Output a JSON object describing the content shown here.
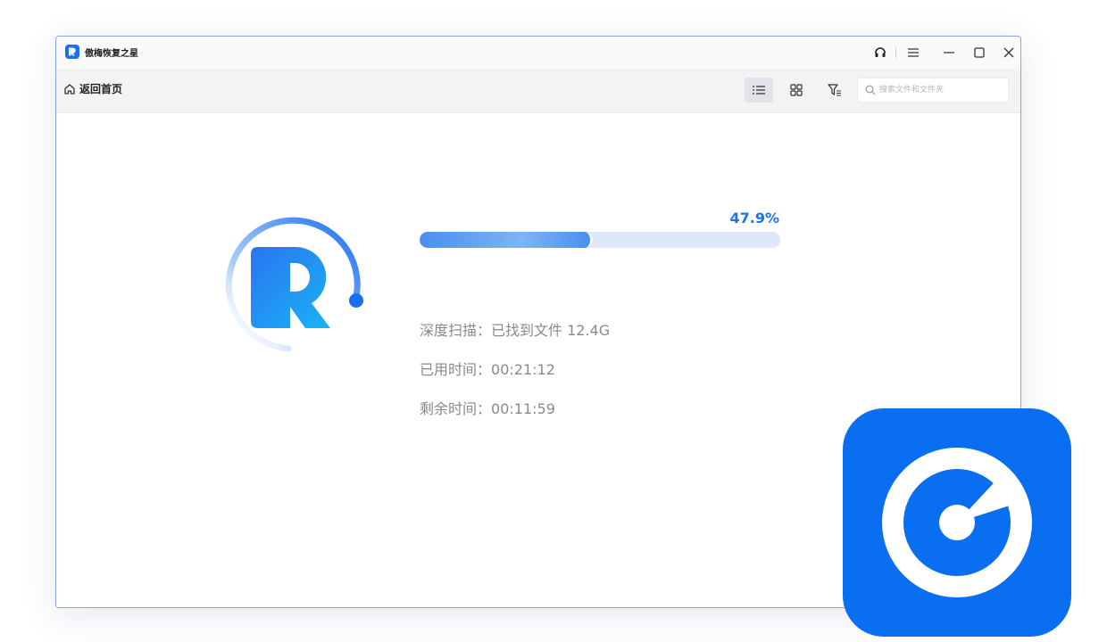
{
  "app": {
    "title": "傲梅恢复之星"
  },
  "toolbar": {
    "home_label": "返回首页",
    "search_placeholder": "搜索文件和文件夹"
  },
  "scan": {
    "progress_percent_label": "47.9%",
    "progress_fraction": 0.479,
    "deep_scan_label": "深度扫描：",
    "deep_scan_value": "已找到文件 12.4G",
    "elapsed_label": "已用时间：",
    "elapsed_value": "00:21:12",
    "remaining_label": "剩余时间：",
    "remaining_value": "00:11:59"
  },
  "icons": {
    "titlebar": [
      "headset-icon",
      "menu-icon",
      "minimize-icon",
      "maximize-icon",
      "close-icon"
    ],
    "toolbar": [
      "home-icon",
      "list-view-icon",
      "grid-view-icon",
      "filter-icon",
      "search-icon"
    ],
    "badge": "scan-disk-icon"
  },
  "colors": {
    "accent": "#1a73e8",
    "badge": "#0a6ef0",
    "progress_track": "#dfe7fa",
    "window_border": "#8ea2ea"
  }
}
